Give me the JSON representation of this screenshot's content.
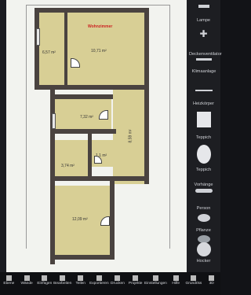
{
  "plan": {
    "room_wohnzimmer_label": "Wohnzimmer",
    "room_wohnzimmer_size": "10,71 m²",
    "room_left_size": "6,57 m²",
    "room_mid_size": "7,32 m²",
    "room_corridor_size": "8,59 m²",
    "room_small_size": "1,1 m²",
    "room_bath_size": "3,74 m²",
    "room_bottom_size": "12,09 m²"
  },
  "panel": {
    "items": [
      {
        "label": "Lampe",
        "icon": "lamp-icon"
      },
      {
        "label": "Deckenventilator",
        "icon": "ceiling-fan-icon"
      },
      {
        "label": "Klimaanlage",
        "icon": "air-conditioner-icon"
      },
      {
        "label": "Heizkörper",
        "icon": "radiator-icon"
      },
      {
        "label": "Teppich",
        "icon": "rug-rect-icon"
      },
      {
        "label": "Teppich",
        "icon": "rug-round-icon"
      },
      {
        "label": "Vorhänge",
        "icon": "curtains-icon"
      },
      {
        "label": "Person",
        "icon": "person-icon"
      },
      {
        "label": "Pflanze",
        "icon": "plant-icon"
      },
      {
        "label": "Hocker",
        "icon": "stool-icon"
      }
    ]
  },
  "toolbar": {
    "items": [
      {
        "label": "Ebene",
        "icon": "layers-icon"
      },
      {
        "label": "Wände",
        "icon": "walls-icon"
      },
      {
        "label": "Einfügen",
        "icon": "insert-icon"
      },
      {
        "label": "Bearbeiten",
        "icon": "edit-icon"
      },
      {
        "label": "Teilen",
        "icon": "share-icon"
      },
      {
        "label": "Exportieren",
        "icon": "export-icon"
      },
      {
        "label": "Drucken",
        "icon": "print-icon"
      },
      {
        "label": "Projekte",
        "icon": "projects-icon"
      },
      {
        "label": "Einstellungen",
        "icon": "settings-icon"
      },
      {
        "label": "Hilfe",
        "icon": "help-icon"
      },
      {
        "label": "Grundriss",
        "icon": "floorplan-icon"
      },
      {
        "label": "3D",
        "icon": "3d-icon"
      }
    ]
  }
}
